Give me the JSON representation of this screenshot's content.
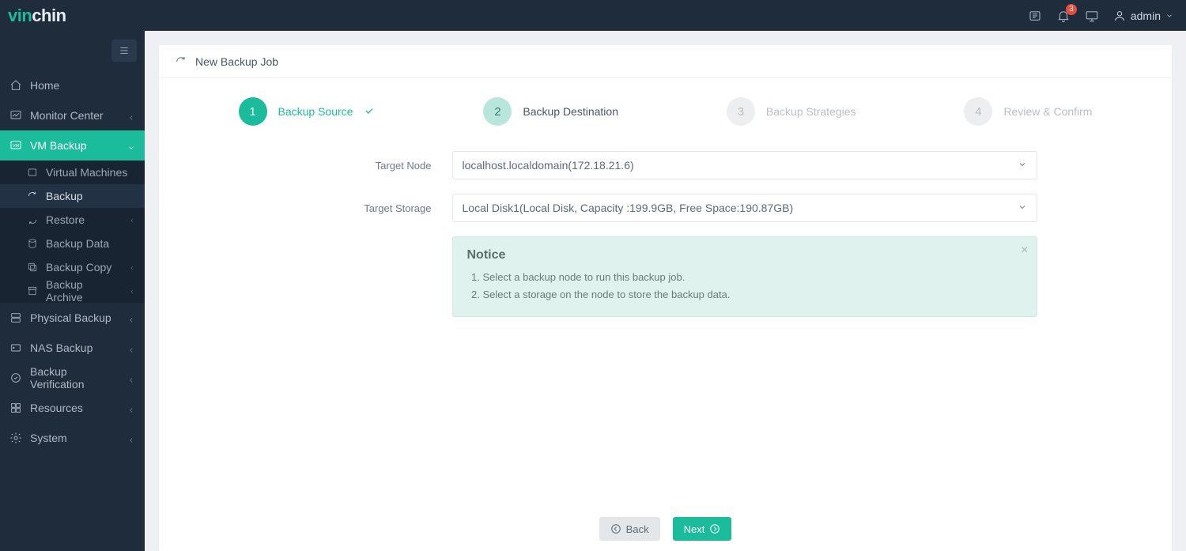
{
  "brand": {
    "accent": "vin",
    "rest": "chin"
  },
  "topbar": {
    "notification_count": "3",
    "user_label": "admin"
  },
  "sidebar": {
    "home": "Home",
    "monitor_center": "Monitor Center",
    "vm_backup": "VM Backup",
    "sub": {
      "virtual_machines": "Virtual Machines",
      "backup": "Backup",
      "restore": "Restore",
      "backup_data": "Backup Data",
      "backup_copy": "Backup Copy",
      "backup_archive": "Backup Archive"
    },
    "physical_backup": "Physical Backup",
    "nas_backup": "NAS Backup",
    "backup_verification": "Backup Verification",
    "resources": "Resources",
    "system": "System"
  },
  "page": {
    "title": "New Backup Job"
  },
  "steps": {
    "s1_num": "1",
    "s1_label": "Backup Source",
    "s2_num": "2",
    "s2_label": "Backup Destination",
    "s3_num": "3",
    "s3_label": "Backup Strategies",
    "s4_num": "4",
    "s4_label": "Review & Confirm"
  },
  "form": {
    "target_node_label": "Target Node",
    "target_node_value": "localhost.localdomain(172.18.21.6)",
    "target_storage_label": "Target Storage",
    "target_storage_value": "Local Disk1(Local Disk, Capacity :199.9GB, Free Space:190.87GB)"
  },
  "notice": {
    "title": "Notice",
    "line1": "Select a backup node to run this backup job.",
    "line2": "Select a storage on the node to store the backup data."
  },
  "footer": {
    "back": "Back",
    "next": "Next"
  }
}
